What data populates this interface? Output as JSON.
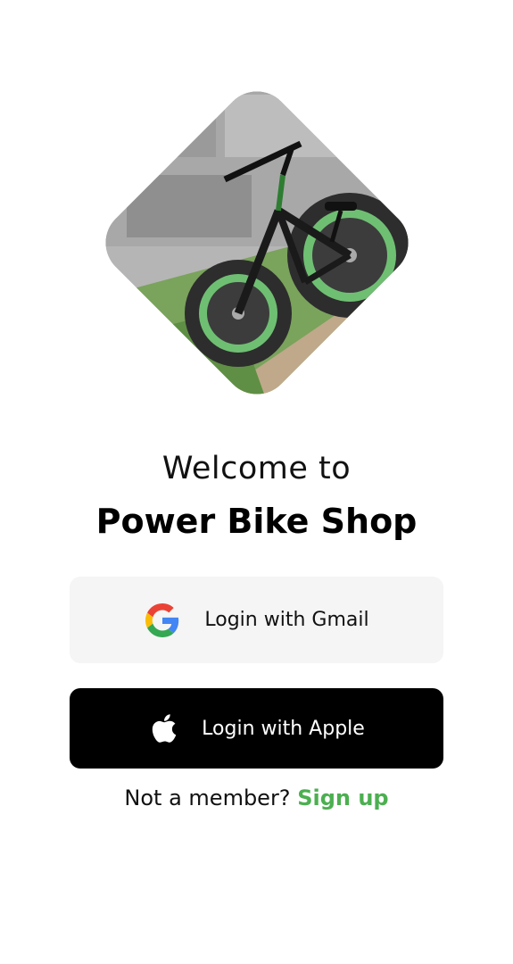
{
  "hero": {
    "image_name": "fat-tire-bike-photo"
  },
  "welcome": {
    "line1": "Welcome to",
    "line2": "Power Bike Shop"
  },
  "buttons": {
    "gmail_label": "Login with Gmail",
    "apple_label": "Login with Apple"
  },
  "signup": {
    "prompt": "Not a member?",
    "link": "Sign up"
  },
  "icons": {
    "gmail": "google-g-icon",
    "apple": "apple-logo-icon"
  },
  "colors": {
    "accent_green": "#4caf50",
    "gmail_button_bg": "#f5f5f5",
    "apple_button_bg": "#000000"
  }
}
